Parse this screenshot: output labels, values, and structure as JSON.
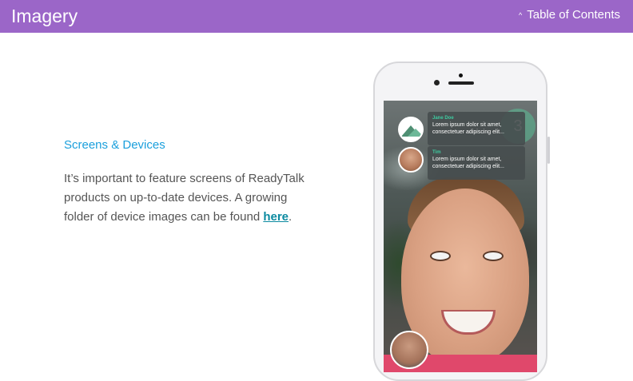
{
  "header": {
    "title": "Imagery",
    "toc_label": "Table of Contents",
    "toc_caret": "^",
    "background": "#9b66c8"
  },
  "content": {
    "heading": "Screens & Devices",
    "body_text": "It’s important to feature screens of ReadyTalk products on up-to-date devices. A growing folder of device images can be found ",
    "link_text": "here",
    "after_link": ".",
    "heading_color": "#1a9fdc",
    "link_color": "#0b8aa0"
  },
  "phone": {
    "notifications": [
      {
        "name": "Jane Doe",
        "message": "Lorem ipsum dolor sit amet, consectetuer adipiscing elit..."
      },
      {
        "name": "Tim",
        "message": "Lorem ipsum dolor sit amet, consectetuer adipiscing elit..."
      }
    ],
    "count": "3"
  }
}
